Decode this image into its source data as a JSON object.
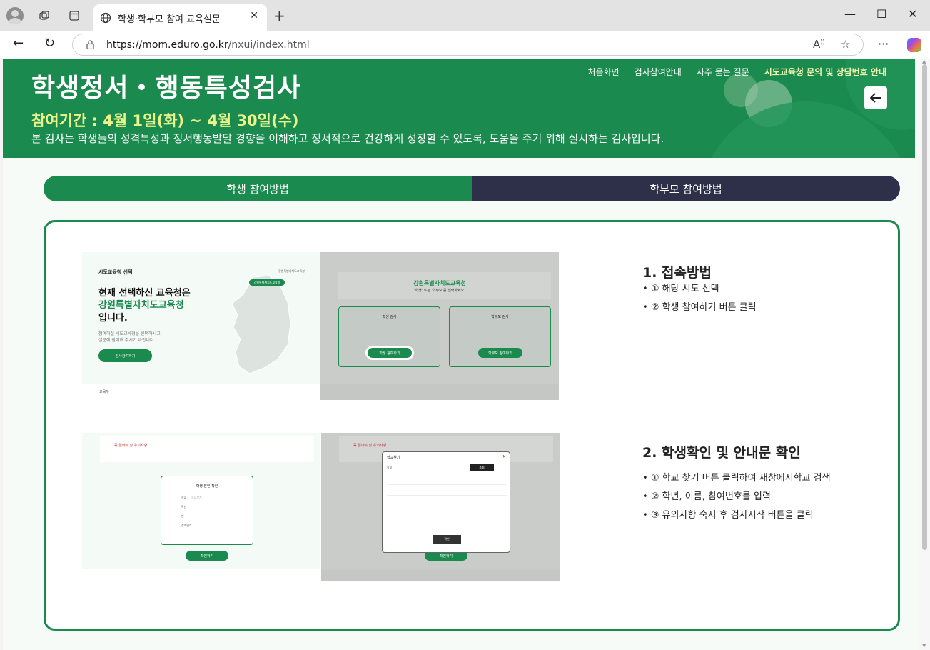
{
  "browser": {
    "tab_title": "학생·학부모 참여 교육설문",
    "url_domain": "https://mom.eduro.go.kr",
    "url_path": "/nxui/index.html"
  },
  "hero": {
    "title": "학생정서・행동특성검사",
    "period": "참여기간 : 4월 1일(화) ~ 4월 30일(수)",
    "description": "본 검사는 학생들의 성격특성과 정서행동발달 경향을 이해하고 정서적으로 건강하게 성장할 수 있도록, 도움을 주기 위해 실시하는 검사입니다."
  },
  "top_nav": [
    "처음화면",
    "검사참여안내",
    "자주 묻는 질문",
    "시도교육청 문의 및 상담번호 안내"
  ],
  "tabs": {
    "student": "학생 참여방법",
    "parent": "학부모 참여방법"
  },
  "steps": [
    {
      "title": "1. 접속방법",
      "items": [
        "① 해당 시도 선택",
        "② 학생 참여하기 버튼 클릭"
      ]
    },
    {
      "title": "2. 학생확인 및 안내문 확인",
      "items": [
        "① 학교 찾기 버튼 클릭하여 새창에서학교 검색",
        "② 학년, 이름, 참여번호를 입력",
        "③ 유의사항 숙지 후 검사시작 버튼을 클릭"
      ]
    }
  ],
  "shot1": {
    "label": "시도교육청 선택",
    "line1": "현재 선택하신 교육청은",
    "line2": "강원특별자치도교육청",
    "line3": "입니다.",
    "small1": "참여하실 시도교육청을 선택하시고",
    "small2": "설문에 참여해 주시기 바랍니다.",
    "button": "검사참여하기",
    "map_badge": "강원특별자치도교육청",
    "select": "강원특별자치도교육청",
    "footer_logo": "교육부"
  },
  "shot2": {
    "title": "강원특별자치도교육청",
    "subtitle": "'학생' 또는 '학부모'를 선택하세요.",
    "student_card": "학생 검사",
    "student_btn": "학생 참여하기",
    "parent_card": "학부모 검사",
    "parent_btn": "학부모 참여하기"
  },
  "shot3": {
    "notice": "꼭 읽어야 할 유의사항",
    "box_title": "학생 본인 확인",
    "fields": [
      "학교",
      "학년",
      "반",
      "참여번호"
    ],
    "school_placeholder": "학교찾기",
    "button": "확인하기"
  },
  "shot4": {
    "notice": "꼭 읽어야 할 유의사항",
    "modal_title": "학교찾기",
    "search_label": "학교",
    "search_btn": "조회",
    "confirm": "확인",
    "bottom_btn": "확인하기"
  },
  "colors": {
    "brand_green": "#1a8a4e",
    "navy": "#2e2f48",
    "highlight_yellow": "#e9f58a"
  }
}
